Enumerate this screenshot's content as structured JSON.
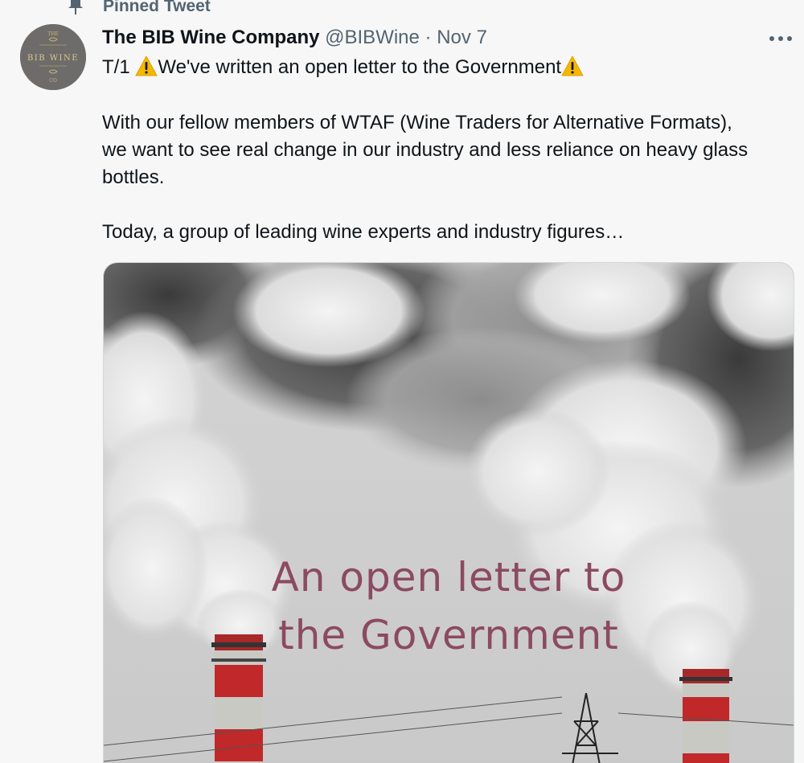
{
  "pinned": {
    "label": "Pinned Tweet",
    "icon": "pin-icon"
  },
  "author": {
    "name": "The BIB Wine Company",
    "handle": "@BIBWine",
    "separator": "·",
    "date": "Nov 7",
    "avatar": {
      "top_text": "THE",
      "middle_text": "BIB WINE",
      "bottom_text": "CO"
    }
  },
  "more_icon": "more-horizontal-icon",
  "tweet": {
    "line1_prefix": "T/1",
    "line1_text": "We've written an open letter to the Government",
    "paragraph2": [
      "With our fellow members of WTAF (Wine Traders for Alternative Formats),",
      "we want to see real change in our industry and less reliance on heavy glass",
      "bottles."
    ],
    "paragraph3": "Today, a group of leading wine experts and industry figures…",
    "warning_icon": "warning-icon"
  },
  "media": {
    "overlay_line1": "An open letter to",
    "overlay_line2": "the Government"
  },
  "colors": {
    "secondary_text": "#536471",
    "overlay_text": "#8c4a62",
    "chimney_red": "#c0282a",
    "background": "#f7f7f7"
  }
}
